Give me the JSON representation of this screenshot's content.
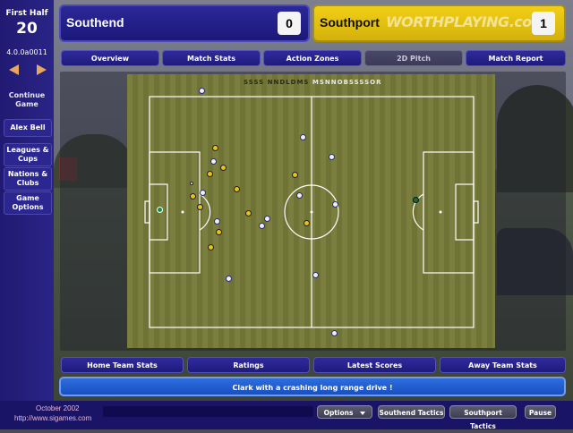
{
  "sidebar": {
    "half": "First Half",
    "day": "20",
    "version": "4.0.0a0011",
    "items": [
      {
        "label1": "Continue",
        "label2": "Game"
      },
      {
        "label1": "Alex Bell",
        "label2": ""
      },
      {
        "label1": "Leagues &",
        "label2": "Cups"
      },
      {
        "label1": "Nations &",
        "label2": "Clubs"
      },
      {
        "label1": "Game",
        "label2": "Options"
      }
    ]
  },
  "score": {
    "home_team": "Southend",
    "home_score": "0",
    "away_team": "Southport",
    "away_score": "1",
    "watermark": "WORTHPLAYING.com"
  },
  "tabs": [
    "Overview",
    "Match Stats",
    "Action Zones",
    "2D Pitch",
    "Match Report"
  ],
  "pitch": {
    "header_home": "SSSS NNDLDMS",
    "header_away": "MSNNOBSSSSOR"
  },
  "bottom_tabs": [
    "Home Team Stats",
    "Ratings",
    "Latest Scores",
    "Away Team Stats"
  ],
  "commentary": "Clark with a crashing long range drive !",
  "footer": {
    "date": "October 2002",
    "url": "http://www.sigames.com",
    "buttons": [
      "Options",
      "Southend Tactics",
      "Southport Tactics",
      "Pause"
    ]
  },
  "colors": {
    "home_kit": "#f0f0f0",
    "away_kit": "#e6c21a",
    "accent": "#2b2899"
  }
}
